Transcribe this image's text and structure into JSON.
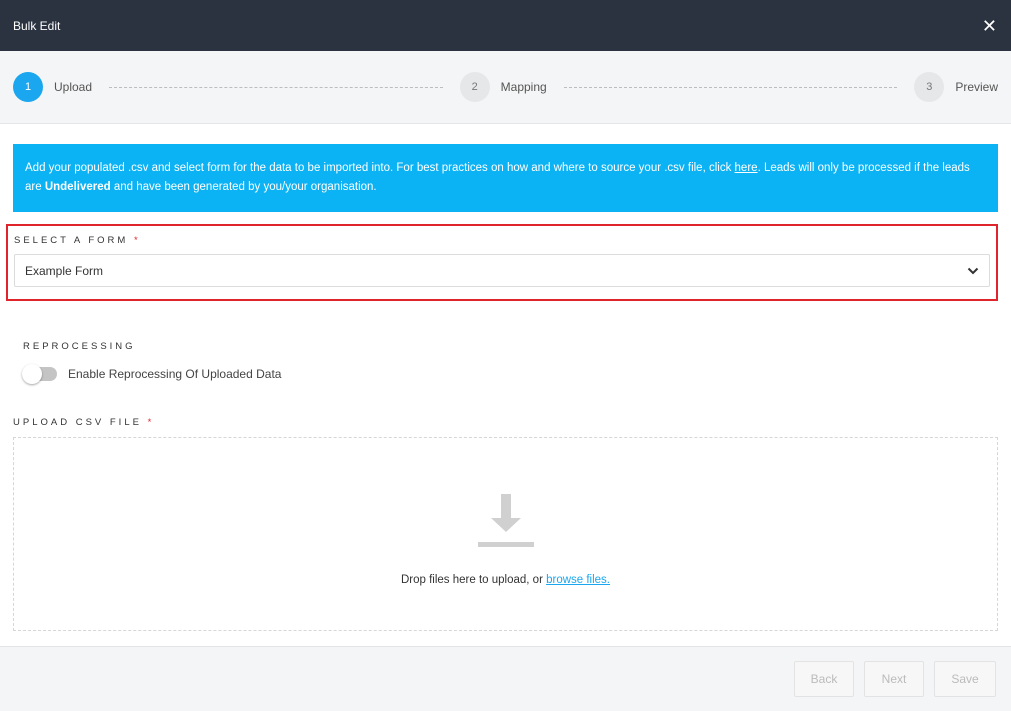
{
  "header": {
    "title": "Bulk Edit",
    "close_icon": "close-icon"
  },
  "steps": [
    {
      "number": "1",
      "label": "Upload",
      "active": true
    },
    {
      "number": "2",
      "label": "Mapping",
      "active": false
    },
    {
      "number": "3",
      "label": "Preview",
      "active": false
    }
  ],
  "info": {
    "text_1": "Add your populated .csv and select form for the data to be imported into. For best practices on how and where to source your .csv file, click ",
    "link": "here",
    "text_2": ". Leads will only be processed if the leads are ",
    "bold": "Undelivered",
    "text_3": " and have been generated by you/your organisation.",
    "background_color": "#0bb2f4"
  },
  "form_select": {
    "label": "SELECT A FORM",
    "required_mark": "*",
    "value": "Example Form",
    "highlight_color": "#e0242b"
  },
  "reprocessing": {
    "label": "REPROCESSING",
    "toggle_label": "Enable Reprocessing Of Uploaded Data",
    "enabled": false
  },
  "upload": {
    "label": "UPLOAD CSV FILE",
    "required_mark": "*",
    "drop_text": "Drop files here to upload, or ",
    "browse_link": "browse files."
  },
  "footer": {
    "back": "Back",
    "next": "Next",
    "save": "Save"
  },
  "colors": {
    "accent": "#1aa7f0",
    "header_bg": "#2b3340"
  }
}
